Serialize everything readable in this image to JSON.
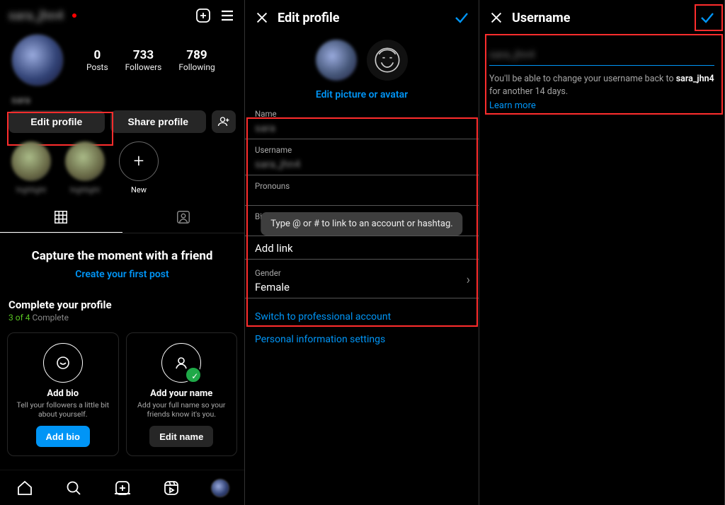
{
  "panel1": {
    "header_username": "sara_jhn4",
    "stats": {
      "posts": {
        "n": "0",
        "l": "Posts"
      },
      "followers": {
        "n": "733",
        "l": "Followers"
      },
      "following": {
        "n": "789",
        "l": "Following"
      }
    },
    "display_name_blur": "sara",
    "buttons": {
      "edit": "Edit profile",
      "share": "Share profile"
    },
    "stories_new": "New",
    "empty": {
      "title": "Capture the moment with a friend",
      "cta": "Create your first post"
    },
    "complete": {
      "title": "Complete your profile",
      "progress_done": "3 of 4",
      "progress_rest": " Complete"
    },
    "card_bio": {
      "title": "Add bio",
      "desc": "Tell your followers a little bit about yourself.",
      "btn": "Add bio"
    },
    "card_name": {
      "title": "Add your name",
      "desc": "Add your full name so your friends know it's you.",
      "btn": "Edit name"
    }
  },
  "panel2": {
    "title": "Edit profile",
    "edit_pic": "Edit picture or avatar",
    "labels": {
      "name": "Name",
      "username": "Username",
      "pronouns": "Pronouns",
      "bio": "Bio",
      "addlink": "Add link",
      "gender": "Gender"
    },
    "values": {
      "name": "sara",
      "username": "sara_jhn4",
      "gender": "Female"
    },
    "tooltip": "Type @ or # to link to an account or hashtag.",
    "switch_pro": "Switch to professional account",
    "personal_info": "Personal information settings"
  },
  "panel3": {
    "title": "Username",
    "input_value": "sara_jhn4",
    "note_pre": "You'll be able to change your username back to ",
    "note_bold": "sara_jhn4",
    "note_post": " for another 14 days.",
    "learn": "Learn more"
  }
}
